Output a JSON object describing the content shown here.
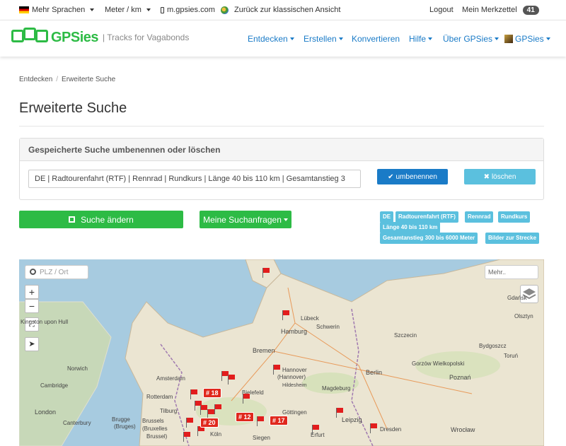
{
  "topbar": {
    "language": "Mehr Sprachen",
    "units": "Meter / km",
    "mobile": "m.gpsies.com",
    "classic": "Zurück zur klassischen Ansicht",
    "logout": "Logout",
    "watchlist": "Mein Merkzettel",
    "watchlist_count": "41"
  },
  "navbar": {
    "logo_text": "GPSies",
    "logo_sub": "| Tracks for Vagabonds",
    "items": [
      "Entdecken",
      "Erstellen",
      "Konvertieren",
      "Hilfe",
      "Über GPSies",
      "GPSies"
    ]
  },
  "breadcrumb": [
    "Entdecken",
    "Erweiterte Suche"
  ],
  "page_title": "Erweiterte Suche",
  "saved_search": {
    "heading": "Gespeicherte Suche umbenennen oder löschen",
    "name_value": "DE | Radtourenfahrt (RTF) | Rennrad | Rundkurs | Länge 40 bis 110 km | Gesamtanstieg 3",
    "rename_label": "umbenennen",
    "delete_label": "löschen"
  },
  "actions": {
    "change_search": "Suche ändern",
    "my_queries": "Meine Suchanfragen"
  },
  "tags": [
    "DE",
    "Radtourenfahrt (RTF)",
    "Rennrad",
    "Rundkurs",
    "Länge 40 bis 110 km",
    "Gesamtanstieg 300 bis 6000 Meter",
    "Bilder zur Strecke"
  ],
  "map": {
    "search_placeholder": "PLZ / Ort",
    "more_placeholder": "Mehr..",
    "zoom_in": "+",
    "zoom_out": "−",
    "places": [
      "Lübeck",
      "Schwerin",
      "Hamburg",
      "Szczecin",
      "Bremen",
      "Berlin",
      "Hannover",
      "(Hannover)",
      "Amsterdam",
      "Magdeburg",
      "Rotterdam",
      "Bielefeld",
      "Tilburg",
      "Brussels",
      "(Bruxelles",
      "Brussel)",
      "Köln",
      "Göttingen",
      "Leipzig",
      "Erfurt",
      "Dresden",
      "Wrocław",
      "Poznań",
      "Gorzów Wielkopolski",
      "Gdańsk",
      "Olsztyn",
      "Bydgoszcz",
      "Toruń",
      "Kingston upon Hull",
      "Norwich",
      "Cambridge",
      "London",
      "Canterbury",
      "Brugge",
      "(Bruges)",
      "Siegen",
      "Hildesheim"
    ],
    "clusters": [
      "# 18",
      "# 12",
      "# 17",
      "# 20"
    ]
  },
  "colors": {
    "brand_green": "#2dbb45",
    "link_blue": "#1a7bc7",
    "info_cyan": "#5bc0de",
    "pin_red": "#e21d1d"
  }
}
